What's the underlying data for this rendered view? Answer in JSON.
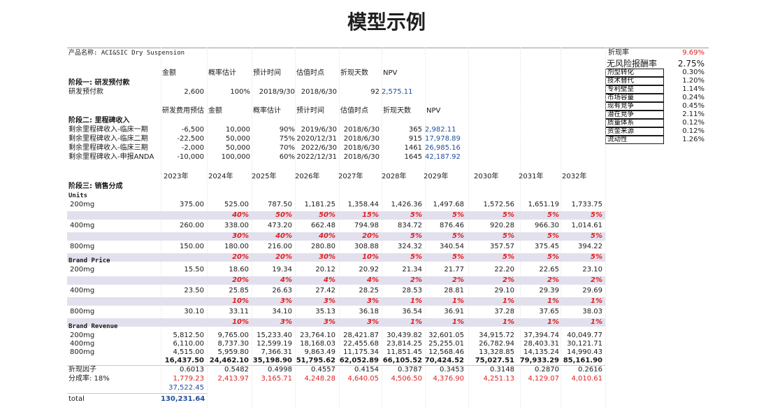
{
  "title": "模型示例",
  "header": {
    "product": "产品名称: ACI&SIC Dry Suspension",
    "discount_label": "折现率",
    "discount_value": "9.69%",
    "riskfree_label": "无风险报酬率",
    "riskfree_value": "2.75%"
  },
  "risk_items": [
    {
      "label": "剂型转化",
      "value": "0.30%"
    },
    {
      "label": "技术替代",
      "value": "1.20%"
    },
    {
      "label": "专利壁垒",
      "value": "1.14%"
    },
    {
      "label": "市场容量",
      "value": "0.24%"
    },
    {
      "label": "现有竞争",
      "value": "0.45%"
    },
    {
      "label": "潜在竞争",
      "value": "2.11%"
    },
    {
      "label": "质量体系",
      "value": "0.12%"
    },
    {
      "label": "资金来源",
      "value": "0.12%"
    },
    {
      "label": "流动性",
      "value": "1.26%"
    }
  ],
  "stage1": {
    "headers": [
      "金额",
      "概率估计",
      "预计时间",
      "估值时点",
      "折现天数",
      "NPV"
    ],
    "title": "阶段一: 研发预付款",
    "row": {
      "label": "研发预付款",
      "amount": "2,600",
      "prob": "100%",
      "time": "2018/9/30",
      "val_date": "2018/6/30",
      "days": "92",
      "npv": "2,575.11"
    }
  },
  "stage2": {
    "headers": [
      "研发费用预估",
      "金额",
      "概率估计",
      "预计时间",
      "估值时点",
      "折现天数",
      "NPV"
    ],
    "title": "阶段二: 里程碑收入",
    "rows": [
      {
        "label": "剩余里程碑收入-临床一期",
        "cost": "-6,500",
        "amount": "10,000",
        "prob": "90%",
        "time": "2019/6/30",
        "val_date": "2018/6/30",
        "days": "365",
        "npv": "2,982.11"
      },
      {
        "label": "剩余里程碑收入-临床二期",
        "cost": "-22,500",
        "amount": "50,000",
        "prob": "75%",
        "time": "2020/12/31",
        "val_date": "2018/6/30",
        "days": "915",
        "npv": "17,978.89"
      },
      {
        "label": "剩余里程碑收入-临床三期",
        "cost": "-2,000",
        "amount": "50,000",
        "prob": "70%",
        "time": "2022/6/30",
        "val_date": "2018/6/30",
        "days": "1461",
        "npv": "26,985.16"
      },
      {
        "label": "剩余里程碑收入-申报ANDA",
        "cost": "-10,000",
        "amount": "100,000",
        "prob": "60%",
        "time": "2022/12/31",
        "val_date": "2018/6/30",
        "days": "1645",
        "npv": "42,187.92"
      }
    ]
  },
  "years": [
    "2023年",
    "2024年",
    "2025年",
    "2026年",
    "2027年",
    "2028年",
    "2029年",
    "2030年",
    "2031年",
    "2032年"
  ],
  "stage3_title": "阶段三: 销售分成",
  "units": {
    "title": "Units",
    "rows": [
      {
        "label": "200mg",
        "values": [
          "375.00",
          "525.00",
          "787.50",
          "1,181.25",
          "1,358.44",
          "1,426.36",
          "1,497.68",
          "1,572.56",
          "1,651.19",
          "1,733.75"
        ],
        "growth": [
          "",
          "40%",
          "50%",
          "50%",
          "15%",
          "5%",
          "5%",
          "5%",
          "5%",
          "5%"
        ]
      },
      {
        "label": "400mg",
        "values": [
          "260.00",
          "338.00",
          "473.20",
          "662.48",
          "794.98",
          "834.72",
          "876.46",
          "920.28",
          "966.30",
          "1,014.61"
        ],
        "growth": [
          "",
          "30%",
          "40%",
          "40%",
          "20%",
          "5%",
          "5%",
          "5%",
          "5%",
          "5%"
        ]
      },
      {
        "label": "800mg",
        "values": [
          "150.00",
          "180.00",
          "216.00",
          "280.80",
          "308.88",
          "324.32",
          "340.54",
          "357.57",
          "375.45",
          "394.22"
        ],
        "growth": [
          "",
          "20%",
          "20%",
          "30%",
          "10%",
          "5%",
          "5%",
          "5%",
          "5%",
          "5%"
        ]
      }
    ]
  },
  "price": {
    "title": "Brand Price",
    "rows": [
      {
        "label": "200mg",
        "values": [
          "15.50",
          "18.60",
          "19.34",
          "20.12",
          "20.92",
          "21.34",
          "21.77",
          "22.20",
          "22.65",
          "23.10"
        ],
        "growth": [
          "",
          "20%",
          "4%",
          "4%",
          "4%",
          "2%",
          "2%",
          "2%",
          "2%",
          "2%"
        ]
      },
      {
        "label": "400mg",
        "values": [
          "23.50",
          "25.85",
          "26.63",
          "27.42",
          "28.25",
          "28.53",
          "28.81",
          "29.10",
          "29.39",
          "29.69"
        ],
        "growth": [
          "",
          "10%",
          "3%",
          "3%",
          "3%",
          "1%",
          "1%",
          "1%",
          "1%",
          "1%"
        ]
      },
      {
        "label": "800mg",
        "values": [
          "30.10",
          "33.11",
          "34.10",
          "35.13",
          "36.18",
          "36.54",
          "36.91",
          "37.28",
          "37.65",
          "38.03"
        ],
        "growth": [
          "",
          "10%",
          "3%",
          "3%",
          "3%",
          "1%",
          "1%",
          "1%",
          "1%",
          "1%"
        ]
      }
    ]
  },
  "revenue": {
    "title": "Brand Revenue",
    "rows": [
      {
        "label": "200mg",
        "values": [
          "5,812.50",
          "9,765.00",
          "15,233.40",
          "23,764.10",
          "28,421.87",
          "30,439.82",
          "32,601.05",
          "34,915.72",
          "37,394.74",
          "40,049.77"
        ]
      },
      {
        "label": "400mg",
        "values": [
          "6,110.00",
          "8,737.30",
          "12,599.19",
          "18,168.03",
          "22,455.68",
          "23,814.25",
          "25,255.01",
          "26,782.94",
          "28,403.31",
          "30,121.71"
        ]
      },
      {
        "label": "800mg",
        "values": [
          "4,515.00",
          "5,959.80",
          "7,366.31",
          "9,863.49",
          "11,175.34",
          "11,851.45",
          "12,568.46",
          "13,328.85",
          "14,135.24",
          "14,990.43"
        ]
      }
    ],
    "total": [
      "16,437.50",
      "24,462.10",
      "35,198.90",
      "51,795.62",
      "62,052.89",
      "66,105.52",
      "70,424.52",
      "75,027.51",
      "79,933.29",
      "85,161.90"
    ]
  },
  "discount_factor": {
    "label": "折现因子",
    "values": [
      "0.6013",
      "0.5482",
      "0.4998",
      "0.4557",
      "0.4154",
      "0.3787",
      "0.3453",
      "0.3148",
      "0.2870",
      "0.2616"
    ]
  },
  "share": {
    "label": "分成率: 18%",
    "values": [
      "1,779.23",
      "2,413.97",
      "3,165.71",
      "4,248.28",
      "4,640.05",
      "4,506.50",
      "4,376.90",
      "4,251.13",
      "4,129.07",
      "4,010.61"
    ]
  },
  "subtotal": "37,522.45",
  "total": {
    "label": "total",
    "value": "130,231.64"
  }
}
